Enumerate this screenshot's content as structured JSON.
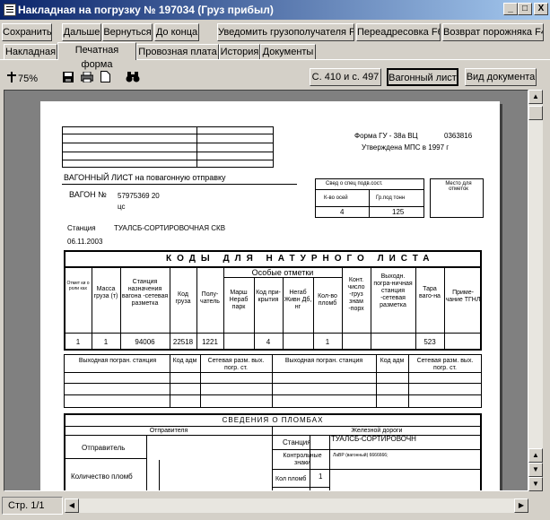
{
  "window": {
    "title": "Накладная на погрузку № 197034 (Груз прибыл)",
    "minimize": "_",
    "maximize": "□",
    "close": "X"
  },
  "toolbar": {
    "save": "Сохранить",
    "next": "Дальше",
    "back": "Вернуться",
    "to_end": "До конца",
    "notify": "Уведомить грузополучателя F10",
    "readdress": "Переадресовка F6",
    "return_empty": "Возврат порожняка F4"
  },
  "tabs": [
    {
      "label": "Накладная"
    },
    {
      "label": "Печатная форма"
    },
    {
      "label": "Провозная плата"
    },
    {
      "label": "История"
    },
    {
      "label": "Документы"
    }
  ],
  "viewer": {
    "zoom": "75%",
    "page_ref": "С. 410 и с. 497",
    "wagon_sheet": "Вагонный лист",
    "doc_view": "Вид документа"
  },
  "status": {
    "page": "Стр. 1/1"
  },
  "document": {
    "form_name": "Форма ГУ - 38а ВЦ",
    "form_code": "0363816",
    "approved": "Утверждена МПС в 1997 г",
    "sheet_title": "ВАГОННЫЙ ЛИСТ на повагонную отправку",
    "wagon_label": "ВАГОН №",
    "wagon_number": "57975369 20",
    "wagon_suffix": "цс",
    "station_label": "Станция",
    "station_name": "ТУАЛСБ-СОРТИРОВОЧНАЯ СКВ",
    "date": "06.11.2003",
    "info_title": "Свед о спец подв.сост.",
    "axles_label": "К-во осей",
    "capacity_label": "Гр.под тонн",
    "axles": "4",
    "capacity": "125",
    "place_label": "Место для отметок",
    "codes_title": "КОДЫ ДЛЯ НАТУРНОГО ЛИСТА",
    "special_marks": "Особые отметки",
    "col_headers": [
      "Отмет ки о роли ках",
      "Масса груза (т)",
      "Станция назначения вагона -сетевая разметка",
      "Код груза",
      "Полу-чатель",
      "Марш Нераб парк",
      "Код при-крытия",
      "Негаб Живн Дб, нг",
      "Кол-во пломб",
      "Конт. число -груз знам -порх",
      "Выходн. погра-ничная станция -сетевая разметка",
      "Тара ваго-на",
      "Приме-чание ТГНЛ"
    ],
    "row_values": [
      "1",
      "1",
      "94006",
      "22518",
      "1221",
      "",
      "4",
      "",
      "1",
      "",
      "",
      "523",
      ""
    ],
    "border_headers": [
      "Выходная погран. станция",
      "Код адм",
      "Сетевая разм. вых. погр. ст.",
      "Выходная погран. станция",
      "Код адм",
      "Сетевая разм. вых. погр. ст."
    ],
    "seals_title": "СВЕДЕНИЯ О ПЛОМБАХ",
    "sender_col": "Отправителя",
    "railway_col": "Железной дороги",
    "sender_label": "Отправитель",
    "seal_count_label": "Количество пломб",
    "station2_label": "Станция",
    "station2_name": "ТУАЛСБ-СОРТИРОВОЧН",
    "control_marks_label": "Контрольные знаки",
    "control_marks_value": "ЛаВР (вагонный) 6666666;",
    "seal_qty_label": "Кол пломб",
    "seal_qty": "1"
  }
}
